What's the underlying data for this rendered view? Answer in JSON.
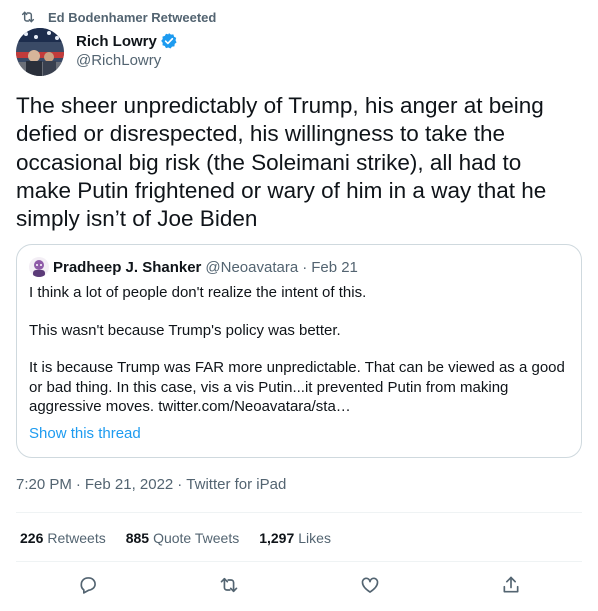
{
  "retweet_banner": {
    "text": "Ed Bodenhamer Retweeted",
    "icon": "retweet-icon"
  },
  "author": {
    "display_name": "Rich Lowry",
    "handle": "@RichLowry",
    "verified": true
  },
  "tweet": {
    "text": "The sheer unpredictably of Trump, his anger at being defied or disrespected, his willingness to take the occasional big risk (the Soleimani strike), all had to make Putin frightened or wary of him in a way that he simply isn’t of Joe Biden"
  },
  "quote": {
    "display_name": "Pradheep J. Shanker",
    "handle": "@Neoavatara",
    "separator": "·",
    "date": "Feb 21",
    "paragraphs": [
      "I think a lot of people don't realize the intent of this.",
      "This wasn't because Trump's policy was better.",
      "It is because Trump was FAR more unpredictable. That can be viewed as a good or bad thing. In this case, vis a vis Putin...it prevented Putin from making aggressive moves. twitter.com/Neoavatara/sta…"
    ],
    "show_thread": "Show this thread"
  },
  "meta": {
    "time": "7:20 PM",
    "separator": "·",
    "date": "Feb 21, 2022",
    "source": "Twitter for iPad"
  },
  "stats": [
    {
      "count": "226",
      "label": "Retweets"
    },
    {
      "count": "885",
      "label": "Quote Tweets"
    },
    {
      "count": "1,297",
      "label": "Likes"
    }
  ],
  "actions": [
    "reply-icon",
    "retweet-icon",
    "like-icon",
    "share-icon"
  ],
  "colors": {
    "text": "#0f1419",
    "secondary": "#536471",
    "accent": "#1d9bf0",
    "border": "#cfd9de"
  }
}
